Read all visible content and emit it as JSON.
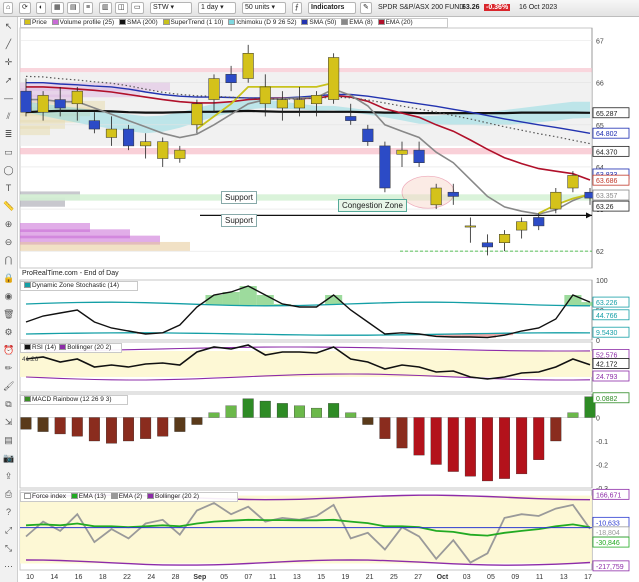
{
  "toolbar": {
    "symbol": "STW",
    "timeframe": "1 day",
    "units": "50 units",
    "indicators_label": "Indicators",
    "instrument_name": "SPDR S&P/ASX 200 FUND",
    "last_price": "63.26",
    "change_pct": "-0.36%",
    "date": "16 Oct 2023"
  },
  "legend_main": [
    "Price",
    "Volume profile (25)",
    "SMA (200)",
    "SuperTrend (1 10)",
    "Ichimoku (D 9 26 52)",
    "SMA (50)",
    "EMA (8)",
    "EMA (20)"
  ],
  "annotations": {
    "support_1": "Support",
    "support_2": "Support",
    "congestion": "Congestion Zone",
    "footer": "ProRealTime.com - End of Day"
  },
  "price_badges": [
    {
      "label": "65.287",
      "color": "#222222"
    },
    {
      "label": "64.802",
      "color": "#1a2bb0"
    },
    {
      "label": "64.370",
      "color": "#222222"
    },
    {
      "label": "63.833",
      "color": "#1a2bb0"
    },
    {
      "label": "63.686",
      "color": "#c0392b"
    },
    {
      "label": "63.357",
      "color": "#888888"
    },
    {
      "label": "63.26",
      "color": "#222222"
    }
  ],
  "panels": {
    "stoch": {
      "legend": "Dynamic Zone Stochastic (14)",
      "values": [
        "63.226",
        "44.766",
        "9.5430"
      ]
    },
    "rsi": {
      "legend": [
        "RSI (14)",
        "Bollinger (20 2)"
      ],
      "values": [
        "52.576",
        "42.172",
        "24.793"
      ],
      "left_label": "41.26"
    },
    "macd": {
      "legend": "MACD Rainbow (12 26 9 3)",
      "values": [
        "0.0882"
      ]
    },
    "force": {
      "legend": [
        "Force index",
        "EMA (13)",
        "EMA (2)",
        "Bollinger (20 2)"
      ],
      "values": [
        "166,671",
        "-10,633",
        "-18,804",
        "-30,846",
        "-217,759"
      ]
    }
  },
  "colors": {
    "up": "#d4c21a",
    "down": "#2c4bc6",
    "sma200": "#111111",
    "sma50": "#2233b0",
    "ema20": "#b0102a",
    "ema8": "#888888",
    "supertrend": "#c8c21c",
    "ichimoku_cloud": "#7fd8e0"
  },
  "chart_data": [
    {
      "type": "candlestick",
      "title": "SPDR S&P/ASX 200 FUND",
      "ylim": [
        61.6,
        67.3
      ],
      "y_ticks": [
        62,
        63,
        64,
        65,
        66,
        67
      ],
      "x_ticks": [
        "10",
        "14",
        "16",
        "18",
        "22",
        "24",
        "28",
        "Sep",
        "05",
        "07",
        "11",
        "13",
        "15",
        "19",
        "21",
        "25",
        "27",
        "Oct",
        "03",
        "05",
        "09",
        "11",
        "13",
        "17"
      ],
      "candles": [
        {
          "o": 65.8,
          "h": 66.1,
          "l": 65.2,
          "c": 65.3
        },
        {
          "o": 65.3,
          "h": 65.8,
          "l": 65.1,
          "c": 65.7
        },
        {
          "o": 65.6,
          "h": 65.9,
          "l": 65.2,
          "c": 65.4
        },
        {
          "o": 65.5,
          "h": 65.9,
          "l": 65.1,
          "c": 65.8
        },
        {
          "o": 65.1,
          "h": 65.3,
          "l": 64.8,
          "c": 64.9
        },
        {
          "o": 64.7,
          "h": 65.2,
          "l": 64.5,
          "c": 64.9
        },
        {
          "o": 64.9,
          "h": 65.0,
          "l": 64.4,
          "c": 64.5
        },
        {
          "o": 64.5,
          "h": 64.8,
          "l": 64.2,
          "c": 64.6
        },
        {
          "o": 64.2,
          "h": 64.7,
          "l": 64.0,
          "c": 64.6
        },
        {
          "o": 64.2,
          "h": 64.5,
          "l": 64.1,
          "c": 64.4
        },
        {
          "o": 65.0,
          "h": 65.6,
          "l": 64.8,
          "c": 65.5
        },
        {
          "o": 65.6,
          "h": 66.2,
          "l": 65.3,
          "c": 66.1
        },
        {
          "o": 66.2,
          "h": 66.4,
          "l": 65.8,
          "c": 66.0
        },
        {
          "o": 66.1,
          "h": 66.9,
          "l": 66.0,
          "c": 66.7
        },
        {
          "o": 65.5,
          "h": 66.2,
          "l": 65.2,
          "c": 65.9
        },
        {
          "o": 65.4,
          "h": 65.8,
          "l": 65.1,
          "c": 65.6
        },
        {
          "o": 65.4,
          "h": 65.9,
          "l": 65.2,
          "c": 65.6
        },
        {
          "o": 65.5,
          "h": 65.8,
          "l": 65.2,
          "c": 65.7
        },
        {
          "o": 65.6,
          "h": 66.7,
          "l": 65.5,
          "c": 66.6
        },
        {
          "o": 65.2,
          "h": 65.5,
          "l": 65.0,
          "c": 65.1
        },
        {
          "o": 64.9,
          "h": 65.0,
          "l": 64.5,
          "c": 64.6
        },
        {
          "o": 64.5,
          "h": 64.6,
          "l": 63.4,
          "c": 63.5
        },
        {
          "o": 64.3,
          "h": 64.6,
          "l": 64.0,
          "c": 64.4
        },
        {
          "o": 64.4,
          "h": 64.6,
          "l": 64.0,
          "c": 64.1
        },
        {
          "o": 63.1,
          "h": 63.6,
          "l": 63.0,
          "c": 63.5
        },
        {
          "o": 63.4,
          "h": 63.6,
          "l": 63.1,
          "c": 63.3
        },
        {
          "o": 62.6,
          "h": 62.8,
          "l": 62.2,
          "c": 62.6
        },
        {
          "o": 62.2,
          "h": 62.4,
          "l": 61.9,
          "c": 62.1
        },
        {
          "o": 62.2,
          "h": 62.5,
          "l": 62.0,
          "c": 62.4
        },
        {
          "o": 62.5,
          "h": 62.8,
          "l": 62.3,
          "c": 62.7
        },
        {
          "o": 62.8,
          "h": 62.9,
          "l": 62.5,
          "c": 62.6
        },
        {
          "o": 63.0,
          "h": 63.5,
          "l": 62.9,
          "c": 63.4
        },
        {
          "o": 63.5,
          "h": 63.9,
          "l": 63.4,
          "c": 63.8
        },
        {
          "o": 63.4,
          "h": 63.5,
          "l": 63.1,
          "c": 63.26
        }
      ],
      "series": [
        {
          "name": "SMA (200)",
          "values": [
            65.3,
            65.32,
            65.33,
            65.33,
            65.33,
            65.32,
            65.3,
            65.29,
            65.29,
            65.3,
            65.31,
            65.31,
            65.32,
            65.33,
            65.32,
            65.31,
            65.31,
            65.31,
            65.31,
            65.31,
            65.3,
            65.29,
            65.29,
            65.28,
            65.28,
            65.28,
            65.28,
            65.28,
            65.28,
            65.29,
            65.29,
            65.29,
            65.29,
            65.287
          ]
        },
        {
          "name": "SMA (50)",
          "values": [
            66.0,
            66.0,
            65.97,
            65.95,
            65.92,
            65.9,
            65.85,
            65.78,
            65.72,
            65.68,
            65.66,
            65.66,
            65.65,
            65.64,
            65.64,
            65.64,
            65.66,
            65.69,
            65.72,
            65.72,
            65.68,
            65.62,
            65.56,
            65.5,
            65.44,
            65.37,
            65.3,
            65.22,
            65.14,
            65.07,
            65.0,
            64.94,
            64.87,
            64.8
          ]
        },
        {
          "name": "EMA (20)",
          "values": [
            65.9,
            65.9,
            65.88,
            65.85,
            65.82,
            65.78,
            65.72,
            65.66,
            65.6,
            65.55,
            65.52,
            65.52,
            65.55,
            65.6,
            65.62,
            65.63,
            65.63,
            65.63,
            65.7,
            65.66,
            65.56,
            65.38,
            65.28,
            65.18,
            65.0,
            64.85,
            64.64,
            64.42,
            64.22,
            64.08,
            63.96,
            63.9,
            63.84,
            63.69
          ]
        },
        {
          "name": "EMA (8)",
          "values": [
            65.6,
            65.6,
            65.55,
            65.55,
            65.4,
            65.25,
            65.1,
            64.95,
            64.8,
            64.7,
            64.78,
            65.0,
            65.25,
            65.5,
            65.6,
            65.62,
            65.64,
            65.65,
            65.85,
            65.7,
            65.45,
            65.0,
            64.85,
            64.7,
            64.35,
            64.1,
            63.7,
            63.3,
            63.05,
            62.95,
            62.88,
            62.98,
            63.2,
            63.36
          ]
        },
        {
          "name": "SuperTrend (1 10)",
          "values": [
            null,
            null,
            null,
            null,
            null,
            null,
            null,
            null,
            null,
            null,
            64.9,
            65.2,
            65.5,
            65.9,
            65.9,
            65.9,
            65.9,
            65.9,
            66.0,
            null,
            null,
            null,
            null,
            null,
            null,
            null,
            null,
            null,
            null,
            null,
            62.9,
            63.1,
            63.25,
            63.35
          ]
        }
      ],
      "support_levels": [
        63.3,
        62.85
      ]
    },
    {
      "type": "line",
      "title": "Dynamic Zone Stochastic (14)",
      "ylim": [
        0,
        100
      ],
      "y_ticks": [
        0,
        50,
        100
      ],
      "series": [
        {
          "name": "Dynamic Zone Stochastic (14)",
          "values": [
            30,
            40,
            45,
            50,
            30,
            20,
            15,
            10,
            12,
            25,
            55,
            75,
            80,
            90,
            75,
            60,
            55,
            55,
            75,
            50,
            30,
            10,
            12,
            10,
            6,
            5,
            5,
            4,
            8,
            15,
            20,
            35,
            75,
            63.2
          ]
        }
      ],
      "levels": [
        63.226,
        44.766,
        9.543
      ]
    },
    {
      "type": "line",
      "title": "RSI (14)",
      "ylim": [
        0,
        100
      ],
      "series": [
        {
          "name": "RSI (14)",
          "values": [
            48,
            50,
            45,
            48,
            40,
            42,
            40,
            43,
            44,
            42,
            55,
            60,
            58,
            62,
            52,
            55,
            55,
            54,
            60,
            48,
            45,
            38,
            42,
            40,
            35,
            36,
            30,
            28,
            30,
            34,
            35,
            40,
            48,
            42.2
          ]
        }
      ],
      "levels": [
        52.576,
        42.172,
        24.793
      ]
    },
    {
      "type": "bar",
      "title": "MACD Rainbow (12 26 9 3)",
      "ylim": [
        -0.3,
        0.1
      ],
      "y_ticks": [
        -0.3,
        -0.2,
        -0.1,
        0
      ],
      "values": [
        -0.05,
        -0.06,
        -0.07,
        -0.08,
        -0.1,
        -0.11,
        -0.1,
        -0.09,
        -0.08,
        -0.06,
        -0.03,
        0.02,
        0.05,
        0.08,
        0.07,
        0.06,
        0.05,
        0.04,
        0.06,
        0.02,
        -0.03,
        -0.09,
        -0.13,
        -0.16,
        -0.2,
        -0.23,
        -0.25,
        -0.27,
        -0.26,
        -0.24,
        -0.18,
        -0.1,
        0.02,
        0.0882
      ]
    },
    {
      "type": "line",
      "title": "Force index",
      "series": [
        {
          "name": "EMA (2)",
          "values": [
            -60000,
            20000,
            -30000,
            60000,
            -90000,
            -20000,
            -70000,
            10000,
            30000,
            -50000,
            80000,
            120000,
            60000,
            100000,
            20000,
            40000,
            30000,
            50000,
            110000,
            -70000,
            -40000,
            -130000,
            -10000,
            -60000,
            -180000,
            -80000,
            -200000,
            -150000,
            40000,
            60000,
            50000,
            90000,
            110000,
            -18804
          ]
        },
        {
          "name": "EMA (13)",
          "values": [
            0,
            5000,
            0,
            10000,
            -5000,
            -5000,
            -10000,
            -5000,
            0,
            -5000,
            10000,
            20000,
            25000,
            30000,
            28000,
            28000,
            27000,
            27000,
            30000,
            20000,
            12000,
            -5000,
            -5000,
            -10000,
            -30000,
            -35000,
            -50000,
            -55000,
            -40000,
            -30000,
            -20000,
            -5000,
            5000,
            -10633
          ]
        }
      ],
      "levels": [
        166671,
        -10633,
        -18804,
        -30846,
        -217759
      ]
    }
  ]
}
